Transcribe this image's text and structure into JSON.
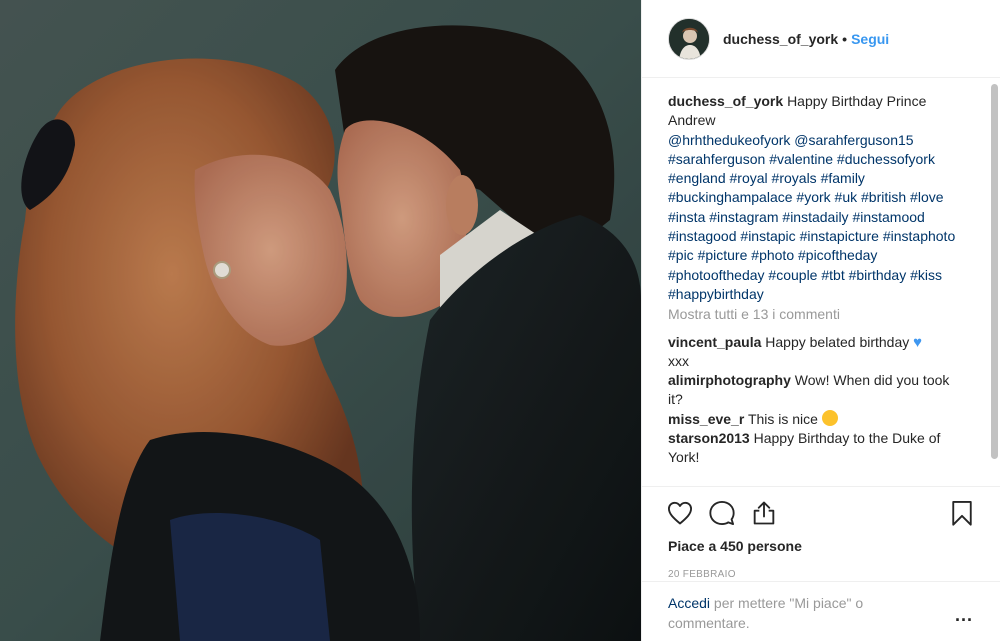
{
  "header": {
    "username": "duchess_of_york",
    "separator": "•",
    "follow_label": "Segui"
  },
  "caption": {
    "username": "duchess_of_york",
    "text": "Happy Birthday Prince Andrew",
    "mentions": [
      "@hrhthedukeofyork",
      "@sarahferguson15"
    ],
    "hashtags": [
      "#sarahferguson",
      "#valentine",
      "#duchessofyork",
      "#england",
      "#royal",
      "#royals",
      "#family",
      "#buckinghampalace",
      "#york",
      "#uk",
      "#british",
      "#love",
      "#insta",
      "#instagram",
      "#instadaily",
      "#instamood",
      "#instagood",
      "#instapic",
      "#instapicture",
      "#instaphoto",
      "#pic",
      "#picture",
      "#photo",
      "#picoftheday",
      "#photooftheday",
      "#couple",
      "#tbt",
      "#birthday",
      "#kiss",
      "#happybirthday"
    ]
  },
  "view_all_comments": "Mostra tutti e 13 i commenti",
  "comments": [
    {
      "username": "vincent_paula",
      "text": "Happy belated birthday",
      "emoji": "blue-heart",
      "text2": "xxx"
    },
    {
      "username": "alimirphotography",
      "text": "Wow! When did you took it?"
    },
    {
      "username": "miss_eve_r",
      "text": "This is nice",
      "emoji": "smiling-face"
    },
    {
      "username": "starson2013",
      "text": "Happy Birthday to the Duke of York!"
    }
  ],
  "actions": {
    "like_icon": "heart-outline-icon",
    "comment_icon": "comment-bubble-icon",
    "share_icon": "share-icon",
    "save_icon": "bookmark-icon"
  },
  "likes_text": "Piace a 450 persone",
  "date": "20 FEBBRAIO",
  "login": {
    "link": "Accedi",
    "text": "per mettere \"Mi piace\" o commentare.",
    "more": "..."
  },
  "colors": {
    "link_blue": "#3897f0",
    "hashtag_navy": "#003569",
    "muted_gray": "#999999",
    "border": "#efefef"
  }
}
